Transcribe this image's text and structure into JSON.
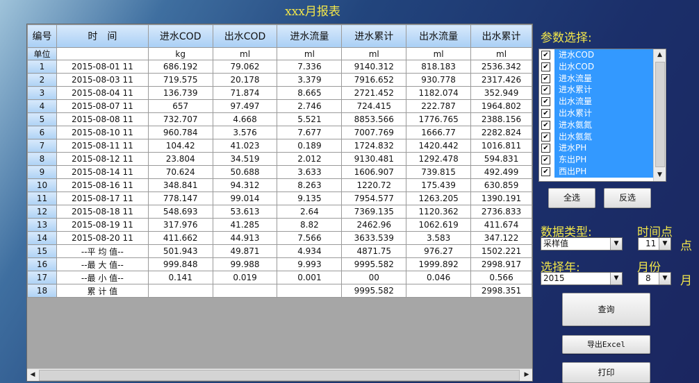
{
  "title": "xxx月报表",
  "table": {
    "headers": [
      "编号",
      "时　间",
      "进水COD",
      "出水COD",
      "进水流量",
      "进水累计",
      "出水流量",
      "出水累计"
    ],
    "unit_row": [
      "单位",
      "",
      "kg",
      "ml",
      "ml",
      "ml",
      "ml",
      "ml"
    ],
    "rows": [
      [
        "1",
        "2015-08-01  11",
        "686.192",
        "79.062",
        "7.336",
        "9140.312",
        "818.183",
        "2536.342"
      ],
      [
        "2",
        "2015-08-03  11",
        "719.575",
        "20.178",
        "3.379",
        "7916.652",
        "930.778",
        "2317.426"
      ],
      [
        "3",
        "2015-08-04  11",
        "136.739",
        "71.874",
        "8.665",
        "2721.452",
        "1182.074",
        "352.949"
      ],
      [
        "4",
        "2015-08-07  11",
        "657",
        "97.497",
        "2.746",
        "724.415",
        "222.787",
        "1964.802"
      ],
      [
        "5",
        "2015-08-08  11",
        "732.707",
        "4.668",
        "5.521",
        "8853.566",
        "1776.765",
        "2388.156"
      ],
      [
        "6",
        "2015-08-10  11",
        "960.784",
        "3.576",
        "7.677",
        "7007.769",
        "1666.77",
        "2282.824"
      ],
      [
        "7",
        "2015-08-11  11",
        "104.42",
        "41.023",
        "0.189",
        "1724.832",
        "1420.442",
        "1016.811"
      ],
      [
        "8",
        "2015-08-12  11",
        "23.804",
        "34.519",
        "2.012",
        "9130.481",
        "1292.478",
        "594.831"
      ],
      [
        "9",
        "2015-08-14  11",
        "70.624",
        "50.688",
        "3.633",
        "1606.907",
        "739.815",
        "492.499"
      ],
      [
        "10",
        "2015-08-16  11",
        "348.841",
        "94.312",
        "8.263",
        "1220.72",
        "175.439",
        "630.859"
      ],
      [
        "11",
        "2015-08-17  11",
        "778.147",
        "99.014",
        "9.135",
        "7954.577",
        "1263.205",
        "1390.191"
      ],
      [
        "12",
        "2015-08-18  11",
        "548.693",
        "53.613",
        "2.64",
        "7369.135",
        "1120.362",
        "2736.833"
      ],
      [
        "13",
        "2015-08-19  11",
        "317.976",
        "41.285",
        "8.82",
        "2462.96",
        "1062.619",
        "411.674"
      ],
      [
        "14",
        "2015-08-20  11",
        "411.662",
        "44.913",
        "7.566",
        "3633.539",
        "3.583",
        "347.122"
      ],
      [
        "15",
        "--平 均 值--",
        "501.943",
        "49.871",
        "4.934",
        "4871.75",
        "976.27",
        "1502.221"
      ],
      [
        "16",
        "--最 大 值--",
        "999.848",
        "99.988",
        "9.993",
        "9995.582",
        "1999.892",
        "2998.917"
      ],
      [
        "17",
        "--最 小 值--",
        "0.141",
        "0.019",
        "0.001",
        "00",
        "0.046",
        "0.566"
      ],
      [
        "18",
        "累 计 值",
        "",
        "",
        "",
        "9995.582",
        "",
        "2998.351"
      ]
    ]
  },
  "params": {
    "label": "参数选择:",
    "items": [
      "进水COD",
      "出水COD",
      "进水流量",
      "进水累计",
      "出水流量",
      "出水累计",
      "进水氨氮",
      "出水氨氮",
      "进水PH",
      "东出PH",
      "西出PH"
    ],
    "select_all": "全选",
    "invert": "反选"
  },
  "data_type": {
    "label": "数据类型:",
    "value": "采样值"
  },
  "time_point": {
    "label": "时间点",
    "value": "11",
    "suffix": "点"
  },
  "year": {
    "label": "选择年:",
    "value": "2015"
  },
  "month": {
    "label": "月份",
    "value": "8",
    "suffix": "月"
  },
  "buttons": {
    "query": "查询",
    "export": "导出Excel",
    "print": "打印"
  },
  "icons": {
    "checkbox": "check-icon",
    "dropdown": "triangle-down",
    "scroll_left": "triangle-left",
    "scroll_right": "triangle-right"
  },
  "colors": {
    "accent_text": "#f2e64a",
    "header_bg": "#a9cff5",
    "selection": "#3399ff"
  }
}
